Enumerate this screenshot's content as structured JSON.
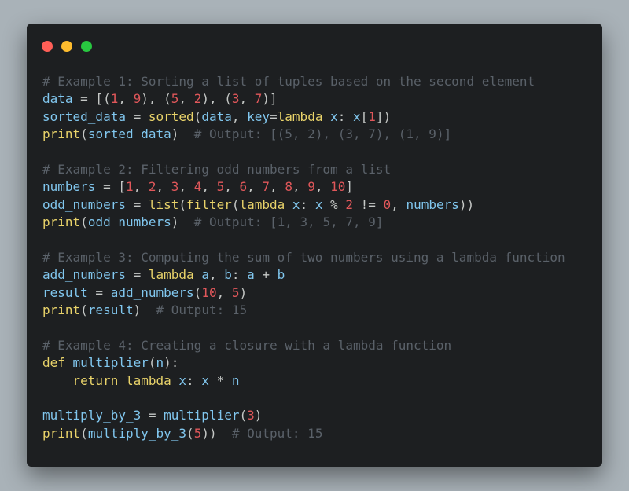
{
  "window": {
    "controls": [
      {
        "name": "close",
        "color": "#ff5f57"
      },
      {
        "name": "minimize",
        "color": "#febc2e"
      },
      {
        "name": "zoom",
        "color": "#28c840"
      }
    ]
  },
  "colors": {
    "background": "#a9b2b8",
    "editor": "#1d1f21",
    "comment": "#5a6169",
    "identifier": "#81c7ef",
    "keyword_function": "#e9d36a",
    "number": "#e0575a",
    "text": "#c5c8c6"
  },
  "code_lines": [
    [
      {
        "t": "# Example 1: Sorting a list of tuples based on the second element",
        "k": "com"
      }
    ],
    [
      {
        "t": "data",
        "k": "var"
      },
      {
        "t": " = [(",
        "k": "txt"
      },
      {
        "t": "1",
        "k": "num"
      },
      {
        "t": ", ",
        "k": "txt"
      },
      {
        "t": "9",
        "k": "num"
      },
      {
        "t": "), (",
        "k": "txt"
      },
      {
        "t": "5",
        "k": "num"
      },
      {
        "t": ", ",
        "k": "txt"
      },
      {
        "t": "2",
        "k": "num"
      },
      {
        "t": "), (",
        "k": "txt"
      },
      {
        "t": "3",
        "k": "num"
      },
      {
        "t": ", ",
        "k": "txt"
      },
      {
        "t": "7",
        "k": "num"
      },
      {
        "t": ")]",
        "k": "txt"
      }
    ],
    [
      {
        "t": "sorted_data",
        "k": "var"
      },
      {
        "t": " = ",
        "k": "txt"
      },
      {
        "t": "sorted",
        "k": "fn"
      },
      {
        "t": "(",
        "k": "txt"
      },
      {
        "t": "data",
        "k": "var"
      },
      {
        "t": ", ",
        "k": "txt"
      },
      {
        "t": "key",
        "k": "var"
      },
      {
        "t": "=",
        "k": "txt"
      },
      {
        "t": "lambda",
        "k": "fn"
      },
      {
        "t": " ",
        "k": "txt"
      },
      {
        "t": "x",
        "k": "var"
      },
      {
        "t": ": ",
        "k": "txt"
      },
      {
        "t": "x",
        "k": "var"
      },
      {
        "t": "[",
        "k": "txt"
      },
      {
        "t": "1",
        "k": "num"
      },
      {
        "t": "])",
        "k": "txt"
      }
    ],
    [
      {
        "t": "print",
        "k": "fn"
      },
      {
        "t": "(",
        "k": "txt"
      },
      {
        "t": "sorted_data",
        "k": "var"
      },
      {
        "t": ")  ",
        "k": "txt"
      },
      {
        "t": "# Output: [(5, 2), (3, 7), (1, 9)]",
        "k": "com"
      }
    ],
    [],
    [
      {
        "t": "# Example 2: Filtering odd numbers from a list",
        "k": "com"
      }
    ],
    [
      {
        "t": "numbers",
        "k": "var"
      },
      {
        "t": " = [",
        "k": "txt"
      },
      {
        "t": "1",
        "k": "num"
      },
      {
        "t": ", ",
        "k": "txt"
      },
      {
        "t": "2",
        "k": "num"
      },
      {
        "t": ", ",
        "k": "txt"
      },
      {
        "t": "3",
        "k": "num"
      },
      {
        "t": ", ",
        "k": "txt"
      },
      {
        "t": "4",
        "k": "num"
      },
      {
        "t": ", ",
        "k": "txt"
      },
      {
        "t": "5",
        "k": "num"
      },
      {
        "t": ", ",
        "k": "txt"
      },
      {
        "t": "6",
        "k": "num"
      },
      {
        "t": ", ",
        "k": "txt"
      },
      {
        "t": "7",
        "k": "num"
      },
      {
        "t": ", ",
        "k": "txt"
      },
      {
        "t": "8",
        "k": "num"
      },
      {
        "t": ", ",
        "k": "txt"
      },
      {
        "t": "9",
        "k": "num"
      },
      {
        "t": ", ",
        "k": "txt"
      },
      {
        "t": "10",
        "k": "num"
      },
      {
        "t": "]",
        "k": "txt"
      }
    ],
    [
      {
        "t": "odd_numbers",
        "k": "var"
      },
      {
        "t": " = ",
        "k": "txt"
      },
      {
        "t": "list",
        "k": "fn"
      },
      {
        "t": "(",
        "k": "txt"
      },
      {
        "t": "filter",
        "k": "fn"
      },
      {
        "t": "(",
        "k": "txt"
      },
      {
        "t": "lambda",
        "k": "fn"
      },
      {
        "t": " ",
        "k": "txt"
      },
      {
        "t": "x",
        "k": "var"
      },
      {
        "t": ": ",
        "k": "txt"
      },
      {
        "t": "x",
        "k": "var"
      },
      {
        "t": " % ",
        "k": "txt"
      },
      {
        "t": "2",
        "k": "num"
      },
      {
        "t": " != ",
        "k": "txt"
      },
      {
        "t": "0",
        "k": "num"
      },
      {
        "t": ", ",
        "k": "txt"
      },
      {
        "t": "numbers",
        "k": "var"
      },
      {
        "t": "))",
        "k": "txt"
      }
    ],
    [
      {
        "t": "print",
        "k": "fn"
      },
      {
        "t": "(",
        "k": "txt"
      },
      {
        "t": "odd_numbers",
        "k": "var"
      },
      {
        "t": ")  ",
        "k": "txt"
      },
      {
        "t": "# Output: [1, 3, 5, 7, 9]",
        "k": "com"
      }
    ],
    [],
    [
      {
        "t": "# Example 3: Computing the sum of two numbers using a lambda function",
        "k": "com"
      }
    ],
    [
      {
        "t": "add_numbers",
        "k": "var"
      },
      {
        "t": " = ",
        "k": "txt"
      },
      {
        "t": "lambda",
        "k": "fn"
      },
      {
        "t": " ",
        "k": "txt"
      },
      {
        "t": "a",
        "k": "var"
      },
      {
        "t": ", ",
        "k": "txt"
      },
      {
        "t": "b",
        "k": "var"
      },
      {
        "t": ": ",
        "k": "txt"
      },
      {
        "t": "a",
        "k": "var"
      },
      {
        "t": " + ",
        "k": "txt"
      },
      {
        "t": "b",
        "k": "var"
      }
    ],
    [
      {
        "t": "result",
        "k": "var"
      },
      {
        "t": " = ",
        "k": "txt"
      },
      {
        "t": "add_numbers",
        "k": "var"
      },
      {
        "t": "(",
        "k": "txt"
      },
      {
        "t": "10",
        "k": "num"
      },
      {
        "t": ", ",
        "k": "txt"
      },
      {
        "t": "5",
        "k": "num"
      },
      {
        "t": ")",
        "k": "txt"
      }
    ],
    [
      {
        "t": "print",
        "k": "fn"
      },
      {
        "t": "(",
        "k": "txt"
      },
      {
        "t": "result",
        "k": "var"
      },
      {
        "t": ")  ",
        "k": "txt"
      },
      {
        "t": "# Output: 15",
        "k": "com"
      }
    ],
    [],
    [
      {
        "t": "# Example 4: Creating a closure with a lambda function",
        "k": "com"
      }
    ],
    [
      {
        "t": "def",
        "k": "fn"
      },
      {
        "t": " ",
        "k": "txt"
      },
      {
        "t": "multiplier",
        "k": "var"
      },
      {
        "t": "(",
        "k": "txt"
      },
      {
        "t": "n",
        "k": "var"
      },
      {
        "t": "):",
        "k": "txt"
      }
    ],
    [
      {
        "t": "    ",
        "k": "txt"
      },
      {
        "t": "return",
        "k": "fn"
      },
      {
        "t": " ",
        "k": "txt"
      },
      {
        "t": "lambda",
        "k": "fn"
      },
      {
        "t": " ",
        "k": "txt"
      },
      {
        "t": "x",
        "k": "var"
      },
      {
        "t": ": ",
        "k": "txt"
      },
      {
        "t": "x",
        "k": "var"
      },
      {
        "t": " * ",
        "k": "txt"
      },
      {
        "t": "n",
        "k": "var"
      }
    ],
    [],
    [
      {
        "t": "multiply_by_3",
        "k": "var"
      },
      {
        "t": " = ",
        "k": "txt"
      },
      {
        "t": "multiplier",
        "k": "var"
      },
      {
        "t": "(",
        "k": "txt"
      },
      {
        "t": "3",
        "k": "num"
      },
      {
        "t": ")",
        "k": "txt"
      }
    ],
    [
      {
        "t": "print",
        "k": "fn"
      },
      {
        "t": "(",
        "k": "txt"
      },
      {
        "t": "multiply_by_3",
        "k": "var"
      },
      {
        "t": "(",
        "k": "txt"
      },
      {
        "t": "5",
        "k": "num"
      },
      {
        "t": "))  ",
        "k": "txt"
      },
      {
        "t": "# Output: 15",
        "k": "com"
      }
    ]
  ]
}
